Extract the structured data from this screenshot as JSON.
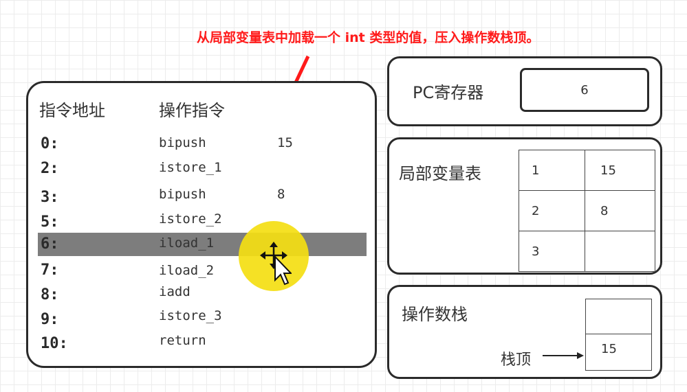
{
  "annotation": "从局部变量表中加载一个 int 类型的值，压入操作数栈顶。",
  "instructions_panel": {
    "header_address": "指令地址",
    "header_instruction": "操作指令",
    "rows": [
      {
        "addr": "0:",
        "op": "bipush",
        "arg": "15"
      },
      {
        "addr": "2:",
        "op": "istore_1",
        "arg": ""
      },
      {
        "addr": "3:",
        "op": "bipush",
        "arg": "8"
      },
      {
        "addr": "5:",
        "op": "istore_2",
        "arg": ""
      },
      {
        "addr": "6:",
        "op": "iload_1",
        "arg": ""
      },
      {
        "addr": "7:",
        "op": "iload_2",
        "arg": ""
      },
      {
        "addr": "8:",
        "op": "iadd",
        "arg": ""
      },
      {
        "addr": "9:",
        "op": "istore_3",
        "arg": ""
      },
      {
        "addr": "10:",
        "op": "return",
        "arg": ""
      }
    ],
    "highlighted_index": 4,
    "highlight_color": "#7d7d7d"
  },
  "pc_register": {
    "label": "PC寄存器",
    "value": "6"
  },
  "local_variable_table": {
    "label": "局部变量表",
    "rows": [
      {
        "index": "1",
        "value": "15"
      },
      {
        "index": "2",
        "value": "8"
      },
      {
        "index": "3",
        "value": ""
      }
    ]
  },
  "operand_stack": {
    "label": "操作数栈",
    "top_label": "栈顶",
    "slots": [
      "",
      "15"
    ]
  },
  "colors": {
    "annotation": "#ff1a1a",
    "cursor_highlight": "#f4de12",
    "border": "#2a2a2a"
  },
  "icons": {
    "cursor": "move-cursor-icon",
    "arrow": "red-pointer-arrow"
  }
}
